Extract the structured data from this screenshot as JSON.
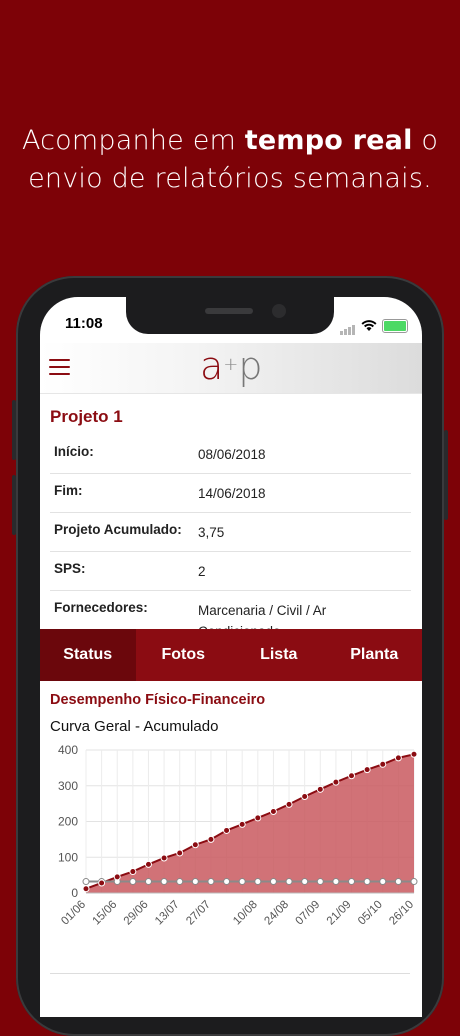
{
  "headline": {
    "part1": "Acompanhe em ",
    "bold": "tempo real",
    "part2": " o",
    "line2": "envio de relatórios semanais."
  },
  "status_bar": {
    "time": "11:08"
  },
  "appbar": {
    "logo_a": "a",
    "logo_plus": "+",
    "logo_p": "p"
  },
  "project": {
    "title": "Projeto 1",
    "rows": [
      {
        "label": "Início:",
        "value": "08/06/2018"
      },
      {
        "label": "Fim:",
        "value": "14/06/2018"
      },
      {
        "label": "Projeto Acumulado:",
        "value": "3,75"
      },
      {
        "label": "SPS:",
        "value": "2"
      },
      {
        "label": "Fornecedores:",
        "value": "Marcenaria / Civil / Ar Condicionado"
      }
    ]
  },
  "tabs": [
    {
      "label": "Status",
      "active": true
    },
    {
      "label": "Fotos",
      "active": false
    },
    {
      "label": "Lista",
      "active": false
    },
    {
      "label": "Planta",
      "active": false
    }
  ],
  "section_title": "Desempenho Físico-Financeiro",
  "chart_title": "Curva Geral - Acumulado",
  "colors": {
    "brand": "#8b0c12",
    "background": "#7d0207",
    "area": "#c9595f",
    "gray_line": "#8a8a8a"
  },
  "chart_data": {
    "type": "area",
    "title": "Curva Geral - Acumulado",
    "ylim": [
      0,
      400
    ],
    "yticks": [
      0,
      100,
      200,
      300,
      400
    ],
    "grid": true,
    "x_tick_labels": [
      "01/06",
      "15/06",
      "29/06",
      "13/07",
      "27/07",
      "10/08",
      "24/08",
      "07/09",
      "21/09",
      "05/10",
      "26/10"
    ],
    "x": [
      "01/06",
      "08/06",
      "15/06",
      "22/06",
      "29/06",
      "06/07",
      "13/07",
      "20/07",
      "27/07",
      "03/08",
      "10/08",
      "17/08",
      "24/08",
      "31/08",
      "07/09",
      "14/09",
      "21/09",
      "28/09",
      "05/10",
      "12/10",
      "19/10",
      "26/10"
    ],
    "series": [
      {
        "values": [
          12,
          28,
          45,
          60,
          80,
          98,
          112,
          135,
          150,
          175,
          192,
          210,
          228,
          248,
          270,
          290,
          310,
          328,
          345,
          360,
          378,
          388
        ]
      },
      {
        "values": [
          32,
          32,
          32,
          32,
          32,
          32,
          32,
          32,
          32,
          32,
          32,
          32,
          32,
          32,
          32,
          32,
          32,
          32,
          32,
          32,
          32,
          32
        ]
      }
    ]
  }
}
